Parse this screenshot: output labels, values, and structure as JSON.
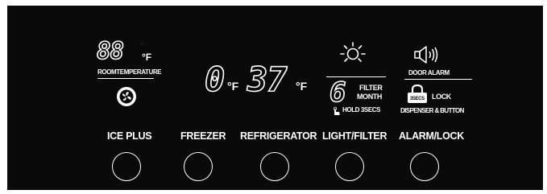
{
  "room_temperature": {
    "display": "88",
    "unit": "°F",
    "small_icon": "c-icon",
    "label": "ROOMTEMPERATURE",
    "icon": "fan-icon"
  },
  "freezer_display": {
    "value": "0",
    "unit": "°F"
  },
  "refrigerator_display": {
    "value": "37",
    "unit": "°F"
  },
  "filter": {
    "icon": "light-bulb-icon",
    "display": "6",
    "label_line1": "FILTER",
    "label_line2": "MONTH",
    "hold_icon": "hand-press-icon",
    "hold_label": "HOLD 3SECS"
  },
  "alarm": {
    "icon": "speaker-icon",
    "door_alarm_label": "DOOR ALARM",
    "lock_icon": "padlock-icon",
    "lock_badge": "3SECS",
    "lock_label": "LOCK",
    "dispenser_label": "DISPENSER & BUTTON"
  },
  "buttons": [
    {
      "label": "ICE PLUS"
    },
    {
      "label": "FREEZER"
    },
    {
      "label": "REFRIGERATOR"
    },
    {
      "label": "LIGHT/FILTER"
    },
    {
      "label": "ALARM/LOCK"
    }
  ],
  "colors": {
    "panel": "#0a0a0a",
    "foreground": "#ffffff",
    "background": "#ffffff"
  }
}
